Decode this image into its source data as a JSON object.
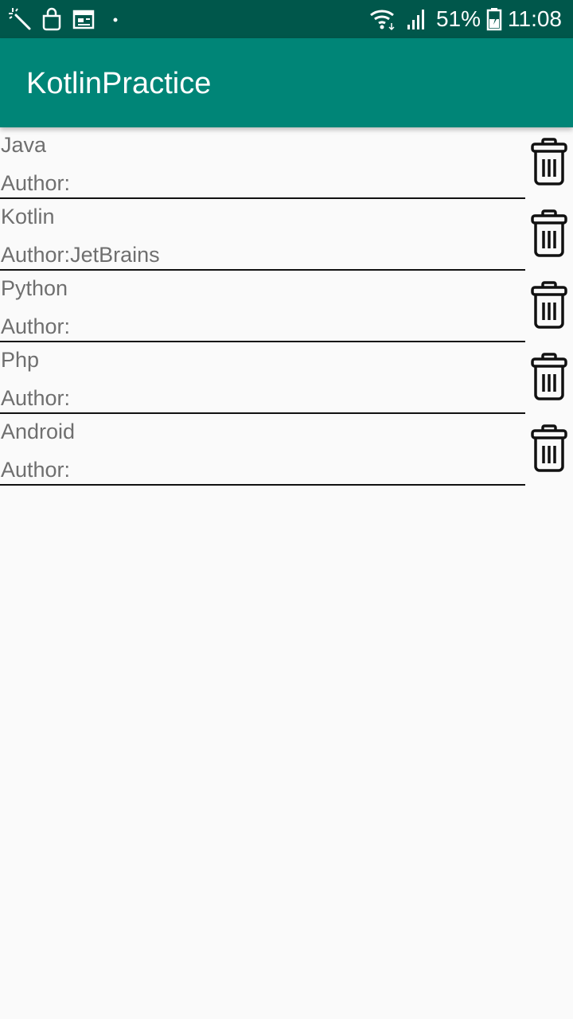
{
  "status_bar": {
    "left_icons": [
      "magic-wand-icon",
      "shopping-bag-icon",
      "calendar-icon",
      "dot-icon"
    ],
    "battery_percent": "51%",
    "time": "11:08",
    "right_icons": [
      "wifi-icon",
      "signal-icon",
      "battery-icon"
    ]
  },
  "app_bar": {
    "title": "KotlinPractice",
    "color": "#008577"
  },
  "colors": {
    "status_bar": "#00574b",
    "text": "#6f6f6f",
    "divider": "#111111",
    "background": "#fafafa"
  },
  "books": [
    {
      "name": "Java",
      "author_prefix": "Author:",
      "author": ""
    },
    {
      "name": "Kotlin",
      "author_prefix": "Author:",
      "author": "JetBrains"
    },
    {
      "name": "Python",
      "author_prefix": "Author:",
      "author": ""
    },
    {
      "name": "Php",
      "author_prefix": "Author:",
      "author": ""
    },
    {
      "name": "Android",
      "author_prefix": "Author:",
      "author": ""
    }
  ],
  "row_action_icon": "trash-icon"
}
